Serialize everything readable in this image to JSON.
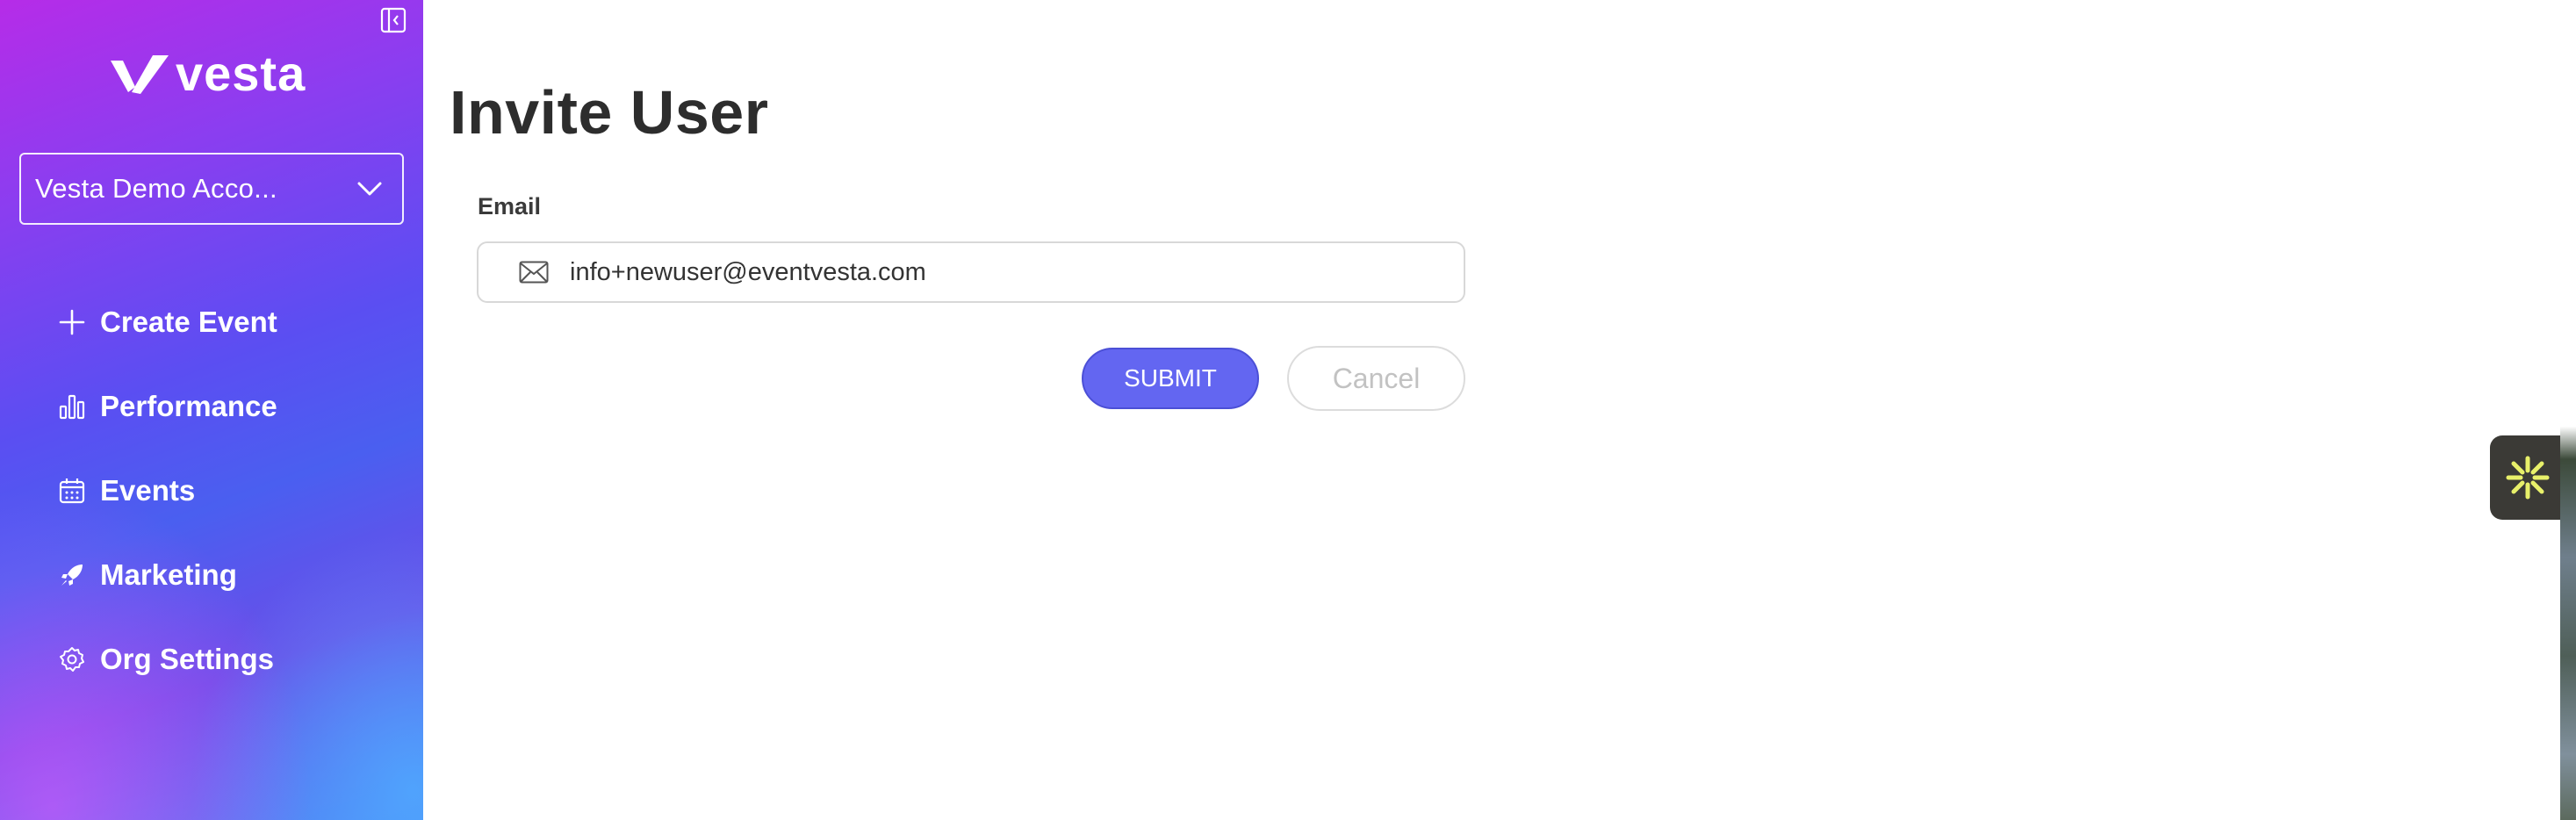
{
  "app": {
    "brand": "vesta",
    "colors": {
      "primary": "#6366f1",
      "sidebar_top": "#b62ce8",
      "sidebar_bottom": "#4b80f3"
    }
  },
  "sidebar": {
    "collapse_icon": "sidebar-collapse-icon",
    "account_selector": {
      "value": "Vesta Demo Acco...",
      "icon": "chevron-down-icon"
    },
    "items": [
      {
        "label": "Create Event",
        "icon": "plus-icon"
      },
      {
        "label": "Performance",
        "icon": "bar-chart-icon"
      },
      {
        "label": "Events",
        "icon": "calendar-icon"
      },
      {
        "label": "Marketing",
        "icon": "rocket-icon"
      },
      {
        "label": "Org Settings",
        "icon": "gear-icon"
      }
    ]
  },
  "main": {
    "title": "Invite User",
    "form": {
      "email_label": "Email",
      "email_value": "info+newuser@eventvesta.com",
      "email_icon": "mail-icon",
      "submit_label": "SUBMIT",
      "cancel_label": "Cancel"
    }
  },
  "widget": {
    "icon": "asterisk-spark-icon"
  }
}
